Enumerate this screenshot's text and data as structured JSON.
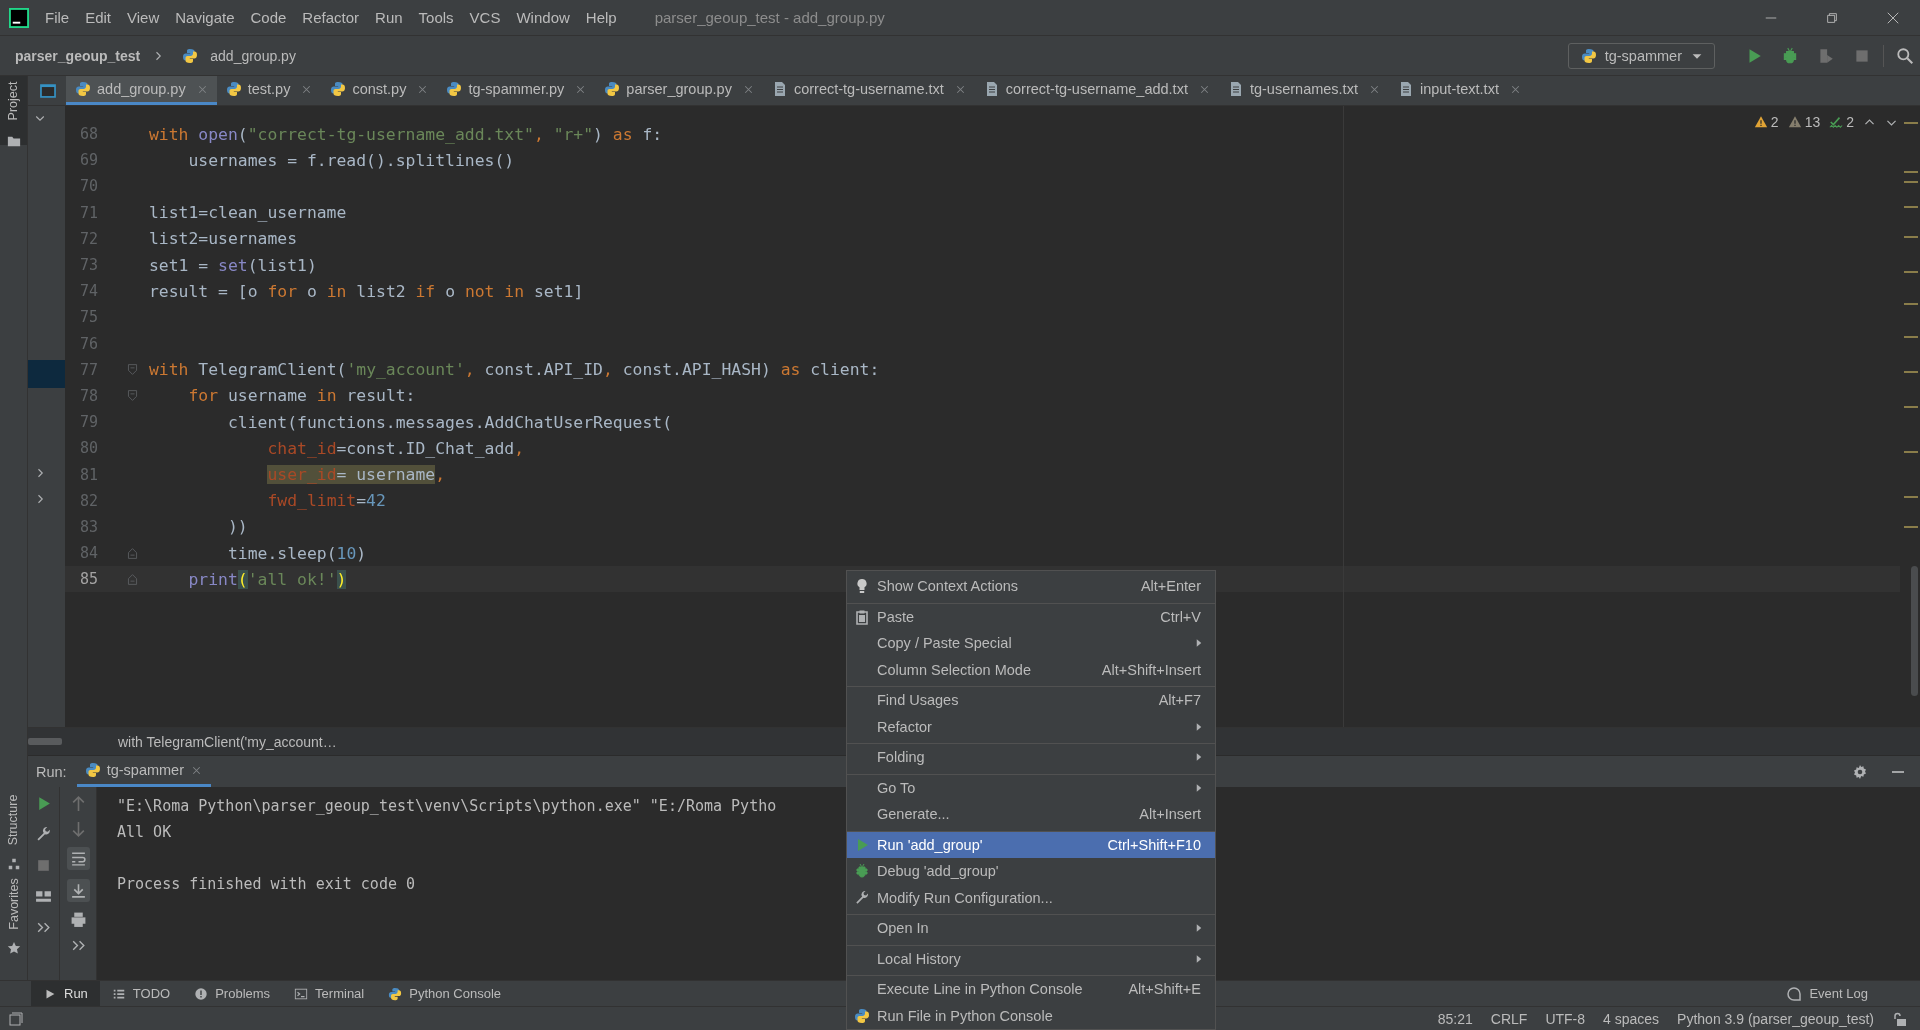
{
  "window": {
    "title": "parser_geoup_test - add_group.py"
  },
  "menu_bar": [
    "File",
    "Edit",
    "View",
    "Navigate",
    "Code",
    "Refactor",
    "Run",
    "Tools",
    "VCS",
    "Window",
    "Help"
  ],
  "breadcrumbs": {
    "project": "parser_geoup_test",
    "file": "add_group.py"
  },
  "run_config": {
    "name": "tg-spammer"
  },
  "side_tabs": [
    {
      "label": "Project",
      "selected": true
    },
    {
      "label": "Structure",
      "selected": false
    },
    {
      "label": "Favorites",
      "selected": false
    }
  ],
  "tabs": [
    {
      "label": "add_group.py",
      "kind": "python",
      "selected": true
    },
    {
      "label": "test.py",
      "kind": "python",
      "selected": false
    },
    {
      "label": "const.py",
      "kind": "python",
      "selected": false
    },
    {
      "label": "tg-spammer.py",
      "kind": "python",
      "selected": false
    },
    {
      "label": "parser_group.py",
      "kind": "python",
      "selected": false
    },
    {
      "label": "correct-tg-username.txt",
      "kind": "text",
      "selected": false
    },
    {
      "label": "correct-tg-username_add.txt",
      "kind": "text",
      "selected": false
    },
    {
      "label": "tg-usernames.txt",
      "kind": "text",
      "selected": false
    },
    {
      "label": "input-text.txt",
      "kind": "text",
      "selected": false
    }
  ],
  "inspections": [
    {
      "kind": "warning",
      "count": "2"
    },
    {
      "kind": "weak_warning",
      "count": "13"
    },
    {
      "kind": "typo",
      "count": "2"
    }
  ],
  "editor": {
    "lines": [
      {
        "number": "68",
        "kind": "plain",
        "current": false,
        "tokens": [
          {
            "text": "with ",
            "kind": "keyword"
          },
          {
            "text": "open",
            "kind": "builtin"
          },
          {
            "text": "(",
            "kind": "plain"
          },
          {
            "text": "\"correct-tg-username_add.txt\"",
            "kind": "string"
          },
          {
            "text": ", ",
            "kind": "keyword"
          },
          {
            "text": "\"r+\"",
            "kind": "string"
          },
          {
            "text": ") ",
            "kind": "plain"
          },
          {
            "text": "as",
            "kind": "keyword"
          },
          {
            "text": " f:",
            "kind": "plain"
          }
        ]
      },
      {
        "number": "69",
        "kind": "plain",
        "current": false,
        "tokens": [
          {
            "text": "    usernames = f.read().splitlines()",
            "kind": "plain"
          }
        ]
      },
      {
        "number": "70",
        "kind": "plain",
        "current": false
      },
      {
        "number": "71",
        "kind": "plain",
        "current": false,
        "tokens": [
          {
            "text": "list1=clean_username",
            "kind": "plain"
          }
        ]
      },
      {
        "number": "72",
        "kind": "plain",
        "current": false,
        "tokens": [
          {
            "text": "list2=usernames",
            "kind": "plain"
          }
        ]
      },
      {
        "number": "73",
        "kind": "plain",
        "current": false,
        "tokens": [
          {
            "text": "set1 = ",
            "kind": "plain"
          },
          {
            "text": "set",
            "kind": "builtin"
          },
          {
            "text": "(list1)",
            "kind": "plain"
          }
        ]
      },
      {
        "number": "74",
        "kind": "plain",
        "current": false,
        "tokens": [
          {
            "text": "result = [o ",
            "kind": "plain"
          },
          {
            "text": "for",
            "kind": "keyword"
          },
          {
            "text": " o ",
            "kind": "plain"
          },
          {
            "text": "in",
            "kind": "keyword"
          },
          {
            "text": " list2 ",
            "kind": "plain"
          },
          {
            "text": "if",
            "kind": "keyword"
          },
          {
            "text": " o ",
            "kind": "plain"
          },
          {
            "text": "not in",
            "kind": "keyword"
          },
          {
            "text": " set1]",
            "kind": "plain"
          }
        ]
      },
      {
        "number": "75",
        "kind": "plain",
        "current": false
      },
      {
        "number": "76",
        "kind": "plain",
        "current": false
      },
      {
        "number": "77",
        "kind": "fold_start",
        "current": false,
        "tokens": [
          {
            "text": "with",
            "kind": "keyword"
          },
          {
            "text": " TelegramClient(",
            "kind": "plain"
          },
          {
            "text": "'my_account'",
            "kind": "string"
          },
          {
            "text": ", ",
            "kind": "keyword"
          },
          {
            "text": "const.API_ID",
            "kind": "plain"
          },
          {
            "text": ", ",
            "kind": "keyword"
          },
          {
            "text": "const.API_HASH) ",
            "kind": "plain"
          },
          {
            "text": "as",
            "kind": "keyword"
          },
          {
            "text": " client:",
            "kind": "plain"
          }
        ]
      },
      {
        "number": "78",
        "kind": "fold_start",
        "current": false,
        "tokens": [
          {
            "text": "    for",
            "kind": "keyword"
          },
          {
            "text": " username ",
            "kind": "plain"
          },
          {
            "text": "in",
            "kind": "keyword"
          },
          {
            "text": " result:",
            "kind": "plain"
          }
        ]
      },
      {
        "number": "79",
        "kind": "plain",
        "current": false,
        "tokens": [
          {
            "text": "        client(functions.messages.AddChatUserRequest(",
            "kind": "plain"
          }
        ]
      },
      {
        "number": "80",
        "kind": "plain",
        "current": false,
        "tokens": [
          {
            "text": "            chat_id",
            "kind": "param"
          },
          {
            "text": "=const.ID_Chat_add",
            "kind": "plain"
          },
          {
            "text": ",",
            "kind": "keyword"
          }
        ]
      },
      {
        "number": "81",
        "kind": "plain",
        "current": false,
        "tokens": [
          {
            "text": "            user_id",
            "kind": "param_marked"
          },
          {
            "text": "= username",
            "kind": "plain_marked"
          },
          {
            "text": ",",
            "kind": "keyword"
          }
        ]
      },
      {
        "number": "82",
        "kind": "plain",
        "current": false,
        "tokens": [
          {
            "text": "            fwd_limit",
            "kind": "param"
          },
          {
            "text": "=",
            "kind": "plain"
          },
          {
            "text": "42",
            "kind": "number"
          }
        ]
      },
      {
        "number": "83",
        "kind": "plain",
        "current": false,
        "tokens": [
          {
            "text": "        ))",
            "kind": "plain"
          }
        ]
      },
      {
        "number": "84",
        "kind": "fold_end",
        "current": false,
        "tokens": [
          {
            "text": "        time.sleep(",
            "kind": "plain"
          },
          {
            "text": "10",
            "kind": "number"
          },
          {
            "text": ")",
            "kind": "plain"
          }
        ]
      },
      {
        "number": "85",
        "kind": "fold_end",
        "current": true,
        "tokens": [
          {
            "text": "    print",
            "kind": "builtin"
          },
          {
            "text": "(",
            "kind": "brace"
          },
          {
            "text": "'all ok!'",
            "kind": "string"
          },
          {
            "text": ")",
            "kind": "brace"
          }
        ]
      }
    ],
    "breadcrumb": "with TelegramClient('my_account…"
  },
  "run_panel": {
    "label": "Run:",
    "tab": "tg-spammer",
    "output": [
      "\"E:\\Roma Python\\parser_geoup_test\\venv\\Scripts\\python.exe\" \"E:/Roma Pytho",
      "All OK"
    ],
    "exit_message": "Process finished with exit code 0"
  },
  "context_menu": [
    {
      "label": "Show Context Actions",
      "shortcut": "Alt+Enter",
      "kind": "bulb",
      "has_submenu": false,
      "separator_before": false,
      "selected": false
    },
    {
      "label": "Paste",
      "shortcut": "Ctrl+V",
      "kind": "clipboard",
      "has_submenu": false,
      "separator_before": true,
      "selected": false
    },
    {
      "label": "Copy / Paste Special",
      "kind": "plain",
      "has_submenu": true,
      "separator_before": false,
      "selected": false
    },
    {
      "label": "Column Selection Mode",
      "shortcut": "Alt+Shift+Insert",
      "kind": "plain",
      "has_submenu": false,
      "separator_before": false,
      "selected": false
    },
    {
      "label": "Find Usages",
      "shortcut": "Alt+F7",
      "kind": "plain",
      "has_submenu": false,
      "separator_before": true,
      "selected": false
    },
    {
      "label": "Refactor",
      "kind": "plain",
      "has_submenu": true,
      "separator_before": false,
      "selected": false
    },
    {
      "label": "Folding",
      "kind": "plain",
      "has_submenu": true,
      "separator_before": true,
      "selected": false
    },
    {
      "label": "Go To",
      "kind": "plain",
      "has_submenu": true,
      "separator_before": true,
      "selected": false
    },
    {
      "label": "Generate...",
      "shortcut": "Alt+Insert",
      "kind": "plain",
      "has_submenu": false,
      "separator_before": false,
      "selected": false
    },
    {
      "label": "Run 'add_group'",
      "shortcut": "Ctrl+Shift+F10",
      "kind": "run",
      "has_submenu": false,
      "separator_before": true,
      "selected": true
    },
    {
      "label": "Debug 'add_group'",
      "kind": "debug",
      "has_submenu": false,
      "separator_before": false,
      "selected": false
    },
    {
      "label": "Modify Run Configuration...",
      "kind": "wrench",
      "has_submenu": false,
      "separator_before": false,
      "selected": false
    },
    {
      "label": "Open In",
      "kind": "plain",
      "has_submenu": true,
      "separator_before": true,
      "selected": false
    },
    {
      "label": "Local History",
      "kind": "plain",
      "has_submenu": true,
      "separator_before": true,
      "selected": false
    },
    {
      "label": "Execute Line in Python Console",
      "shortcut": "Alt+Shift+E",
      "kind": "plain",
      "has_submenu": false,
      "separator_before": true,
      "selected": false
    },
    {
      "label": "Run File in Python Console",
      "kind": "python",
      "has_submenu": false,
      "separator_before": false,
      "selected": false
    }
  ],
  "tool_tabs": [
    {
      "label": "Run",
      "kind": "run",
      "selected": true
    },
    {
      "label": "TODO",
      "kind": "list",
      "selected": false
    },
    {
      "label": "Problems",
      "kind": "problems",
      "selected": false
    },
    {
      "label": "Terminal",
      "kind": "terminal",
      "selected": false
    },
    {
      "label": "Python Console",
      "kind": "python",
      "selected": false
    }
  ],
  "event_log": "Event Log",
  "status_bar": [
    "85:21",
    "CRLF",
    "UTF-8",
    "4 spaces",
    "Python 3.9 (parser_geoup_test)"
  ]
}
